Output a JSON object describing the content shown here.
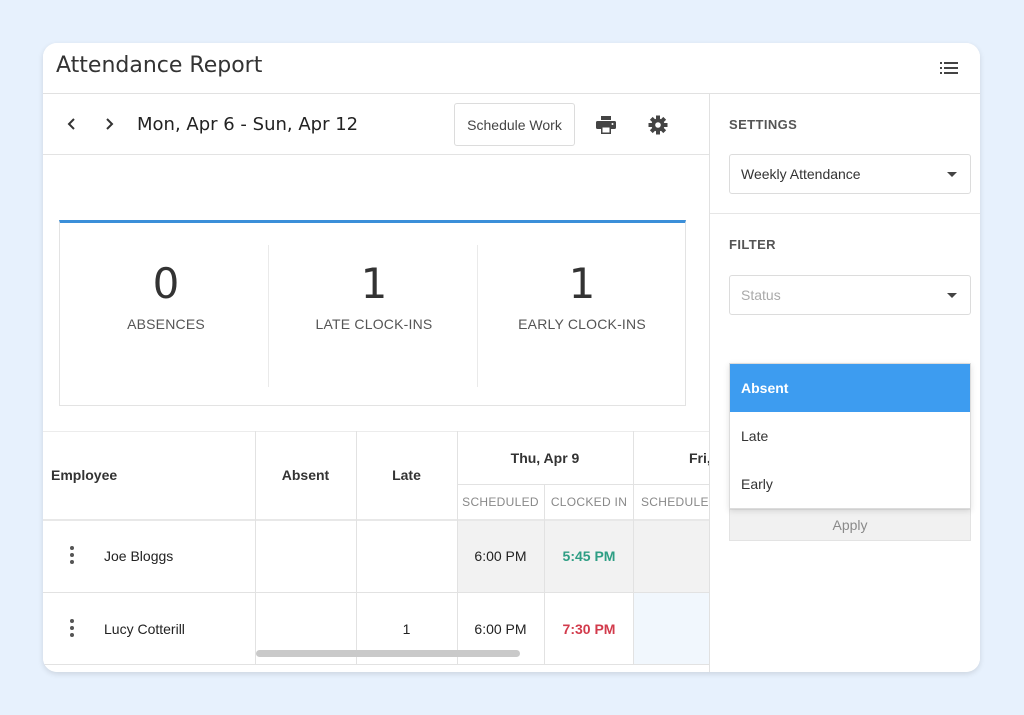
{
  "window": {
    "title": "Attendance Report"
  },
  "toolbar": {
    "date_range": "Mon, Apr 6 - Sun, Apr 12",
    "schedule_label": "Schedule Work"
  },
  "stats": [
    {
      "value": "0",
      "label": "ABSENCES"
    },
    {
      "value": "1",
      "label": "LATE CLOCK-INS"
    },
    {
      "value": "1",
      "label": "EARLY CLOCK-INS"
    }
  ],
  "table": {
    "headers": {
      "employee": "Employee",
      "absent": "Absent",
      "late": "Late",
      "day1": "Thu, Apr 9",
      "day2": "Fri,"
    },
    "subheaders": {
      "scheduled": "SCHEDULED",
      "clocked_in": "CLOCKED IN",
      "scheduled2": "SCHEDULED"
    },
    "rows": [
      {
        "name": "Joe Bloggs",
        "absent": "",
        "late": "",
        "scheduled": "6:00 PM",
        "clocked_in": "5:45 PM",
        "status": "early"
      },
      {
        "name": "Lucy Cotterill",
        "absent": "",
        "late": "1",
        "scheduled": "6:00 PM",
        "clocked_in": "7:30 PM",
        "status": "late"
      }
    ]
  },
  "sidebar": {
    "settings_title": "SETTINGS",
    "report_type": "Weekly Attendance",
    "filter_title": "FILTER",
    "status_placeholder": "Status",
    "status_options": [
      "Absent",
      "Late",
      "Early"
    ],
    "selected_option": "Absent",
    "apply_label": "Apply"
  },
  "colors": {
    "accent": "#3d9cf0",
    "early": "#2e9e84",
    "late": "#d23b4c",
    "background": "#e7f1fd"
  },
  "icons": [
    "menu-icon",
    "chevron-left-icon",
    "chevron-right-icon",
    "printer-icon",
    "gear-icon",
    "kebab-icon",
    "caret-down-icon"
  ]
}
